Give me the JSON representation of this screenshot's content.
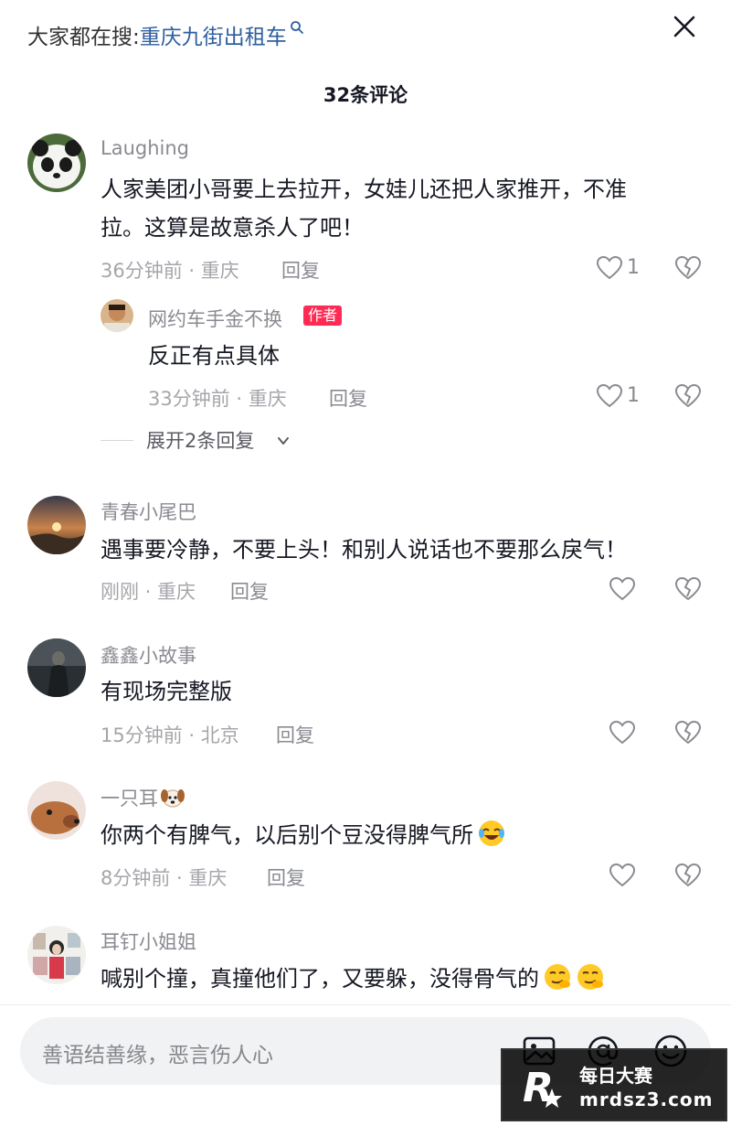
{
  "header": {
    "search_prefix": "大家都在搜:",
    "search_keyword": "重庆九街出租车",
    "count_title": "32条评论"
  },
  "comments": [
    {
      "username": "Laughing",
      "text_line1": "人家美团小哥要上去拉开，女娃儿还把人家推开，不准",
      "text_line2": "拉。这算是故意杀人了吧！",
      "meta": "36分钟前 · 重庆",
      "reply_label": "回复",
      "like_count": "1",
      "avatar_icon": "panda-avatar"
    },
    {
      "username": "网约车手金不换",
      "badge": "作者",
      "text": "反正有点具体",
      "meta": "33分钟前 · 重庆",
      "reply_label": "回复",
      "like_count": "1",
      "avatar_icon": "person-avatar"
    },
    {
      "username": "青春小尾巴",
      "text": "遇事要冷静，不要上头！和别人说话也不要那么戾气！",
      "meta": "刚刚 · 重庆",
      "reply_label": "回复",
      "avatar_icon": "sunset-avatar"
    },
    {
      "username": "鑫鑫小故事",
      "text": "有现场完整版",
      "meta": "15分钟前 · 北京",
      "reply_label": "回复",
      "avatar_icon": "dark-figure-avatar"
    },
    {
      "username": "一只耳",
      "text": "你两个有脾气，以后别个豆没得脾气所",
      "meta": "8分钟前 · 重庆",
      "reply_label": "回复",
      "avatar_icon": "dog-avatar"
    },
    {
      "username": "耳钉小姐姐",
      "text": "喊别个撞，真撞他们了，又要躲，没得骨气的",
      "avatar_icon": "collage-avatar"
    }
  ],
  "expand_replies": "展开2条回复",
  "input": {
    "placeholder": "善语结善缘，恶言伤人心"
  },
  "icons": {
    "close": "close-icon",
    "image": "image-icon",
    "mention": "at-icon",
    "emoji": "emoji-icon"
  },
  "watermark": {
    "line1": "每日大赛",
    "line2": "mrdsz3.com"
  },
  "colors": {
    "keyword": "#2f5f9f",
    "badge": "#fe2c55",
    "text": "#161823",
    "meta": "#a5a6ab"
  }
}
